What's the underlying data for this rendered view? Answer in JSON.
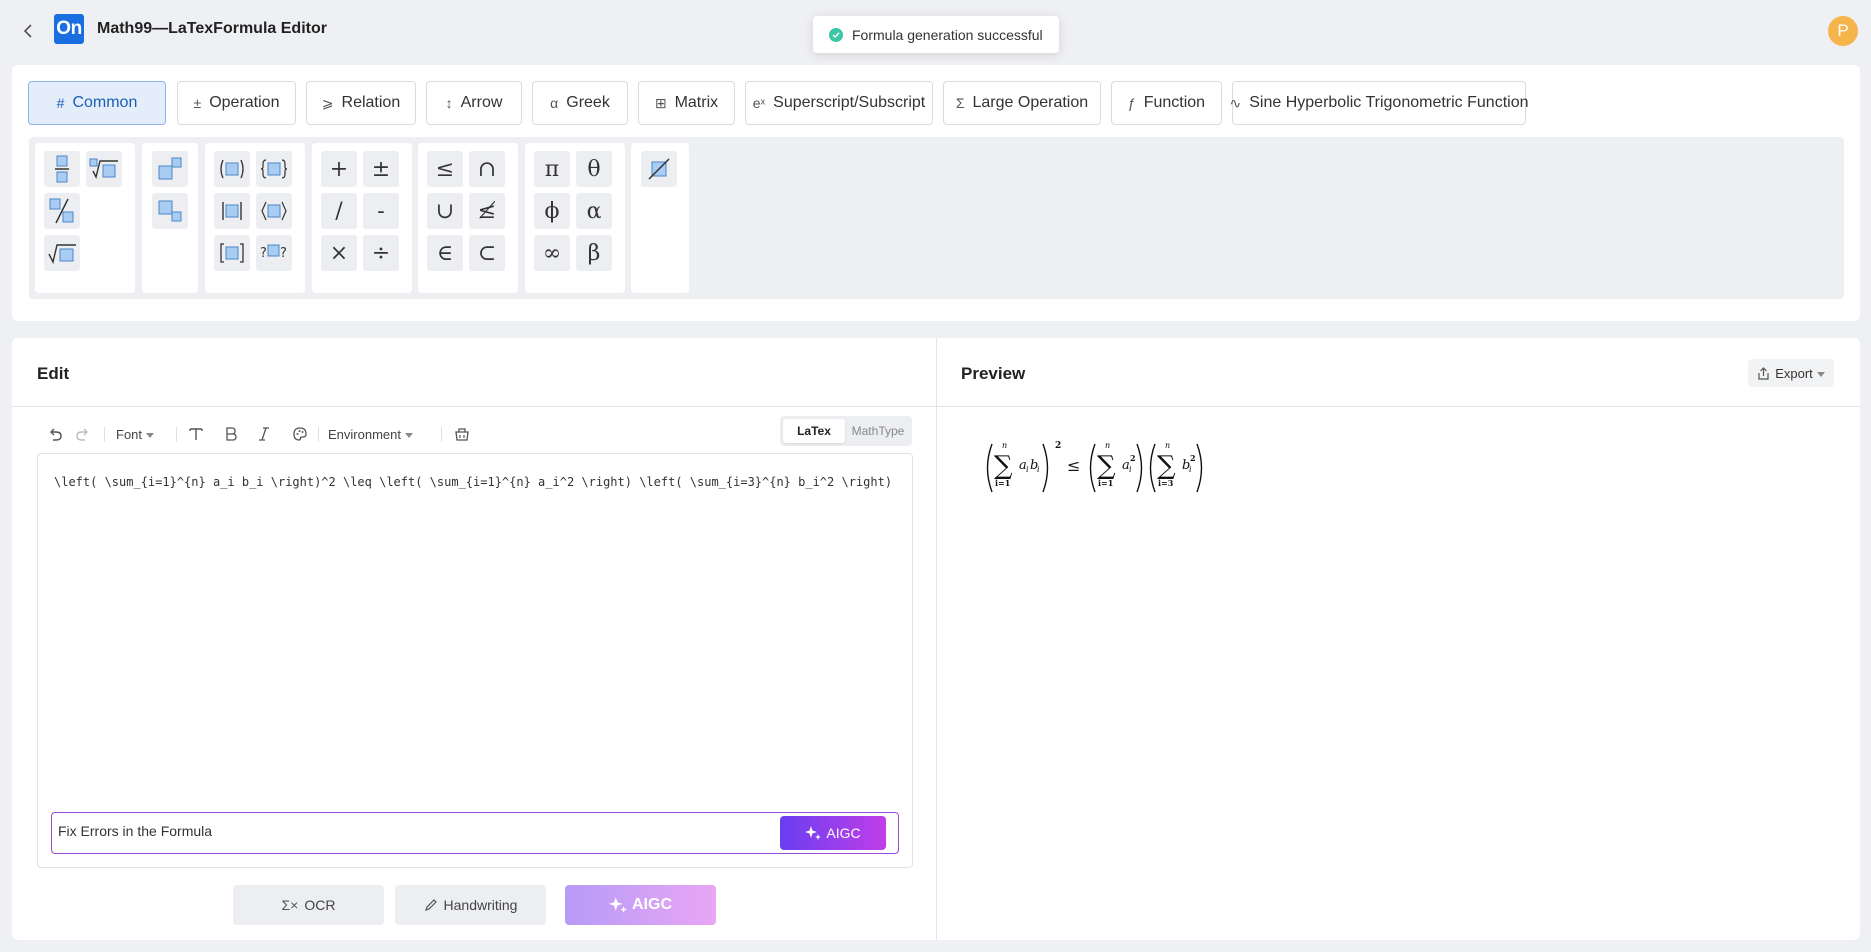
{
  "header": {
    "app_title": "Math99—LaTexFormula Editor",
    "logo_text": "On",
    "avatar_initial": "P"
  },
  "toast": {
    "message": "Formula generation successful"
  },
  "categories": [
    {
      "label": "Common",
      "icon": "hash-icon",
      "glyph": "#",
      "active": true
    },
    {
      "label": "Operation",
      "icon": "operation-icon",
      "glyph": "±",
      "active": false
    },
    {
      "label": "Relation",
      "icon": "relation-icon",
      "glyph": "⩾",
      "active": false
    },
    {
      "label": "Arrow",
      "icon": "arrow-icon",
      "glyph": "↕",
      "active": false
    },
    {
      "label": "Greek",
      "icon": "alpha-icon",
      "glyph": "α",
      "active": false
    },
    {
      "label": "Matrix",
      "icon": "matrix-icon",
      "glyph": "⊞",
      "active": false
    },
    {
      "label": "Superscript/Subscript",
      "icon": "superscript-icon",
      "glyph": "eˣ",
      "active": false
    },
    {
      "label": "Large Operation",
      "icon": "sigma-box-icon",
      "glyph": "Σ",
      "active": false
    },
    {
      "label": "Function",
      "icon": "function-icon",
      "glyph": "ƒ",
      "active": false
    },
    {
      "label": "Sine Hyperbolic Trigonometric Function",
      "icon": "sine-wave-icon",
      "glyph": "∿",
      "active": false
    }
  ],
  "symbols": {
    "operators": [
      "+",
      "±",
      "/",
      "-",
      "×",
      "÷"
    ],
    "relations": [
      "≤",
      "∩",
      "∪",
      "≰",
      "∈",
      "⊂"
    ],
    "greek": [
      "π",
      "θ",
      "ϕ",
      "α",
      "∞",
      "β"
    ]
  },
  "edit": {
    "title": "Edit",
    "font_label": "Font",
    "environment_label": "Environment",
    "mode_latex": "LaTex",
    "mode_mathtype": "MathType",
    "latex_code": "\\left( \\sum_{i=1}^{n} a_i b_i \\right)^2 \\leq \\left( \\sum_{i=1}^{n} a_i^2 \\right) \\left( \\sum_{i=3}^{n} b_i^2 \\right)",
    "aigc_input_value": "Fix Errors in the Formula",
    "aigc_send_label": "AIGC",
    "ocr_label": "OCR",
    "handwriting_label": "Handwriting",
    "aigc_label": "AIGC"
  },
  "preview": {
    "title": "Preview",
    "export_label": "Export",
    "formula": {
      "sum_upper": "n",
      "sum1_lower": "i=1",
      "sum2_lower": "i=1",
      "sum3_lower": "i=3",
      "term1": "a",
      "term1_sub": "i",
      "term1b": "b",
      "term1b_sub": "i",
      "power": "2",
      "leq": "≤",
      "term2": "a",
      "term2_sub": "i",
      "term2_sup": "2",
      "term3": "b",
      "term3_sub": "i",
      "term3_sup": "2"
    }
  },
  "colors": {
    "accent": "#1a6fe0",
    "active_tab_bg": "#e4eefb",
    "aigc_gradient_start": "#6a3ef0",
    "aigc_gradient_end": "#c03ee8",
    "toast_success": "#3cc6a6",
    "avatar": "#f5b54a"
  }
}
